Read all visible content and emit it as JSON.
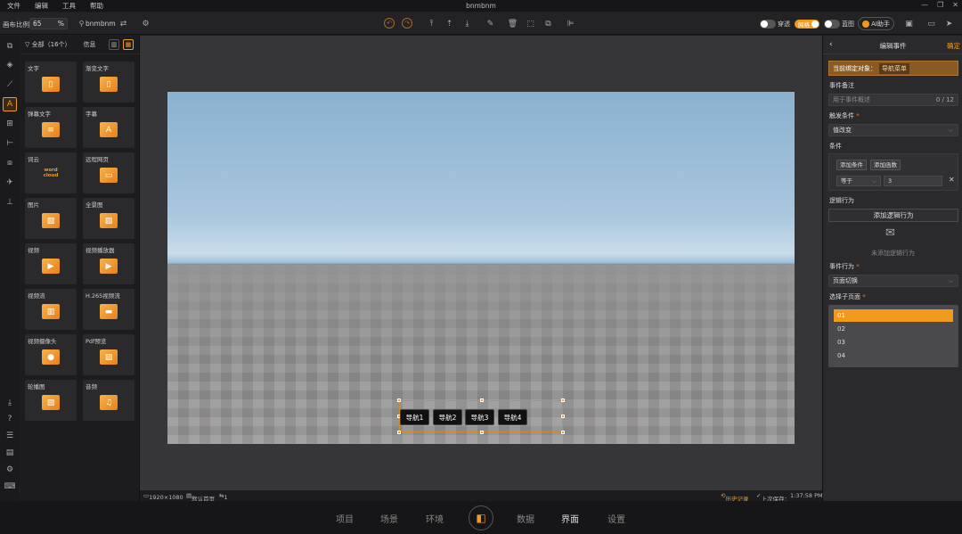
{
  "menubar": {
    "items": [
      "文件",
      "编辑",
      "工具",
      "帮助"
    ],
    "title": "bnmbnm",
    "window_controls": [
      "—",
      "❐",
      "✕"
    ]
  },
  "toolbar": {
    "zoom_label": "画布比例",
    "zoom_value": "65",
    "zoom_unit": "%",
    "project_name": "bnmbnm",
    "toggles": [
      {
        "label": "穿透",
        "on": false
      },
      {
        "label": "网格",
        "on": true
      },
      {
        "label": "蓝图",
        "on": false
      }
    ],
    "ai_label": "AI助手"
  },
  "component_panel": {
    "filter_label": "全部（16个）",
    "info_label": "信息",
    "items": [
      {
        "label": "文字",
        "icon": "▯"
      },
      {
        "label": "渐变文字",
        "icon": "▯"
      },
      {
        "label": "弹幕文字",
        "icon": "≡"
      },
      {
        "label": "字幕",
        "icon": "A"
      },
      {
        "label": "词云",
        "icon": "word cloud"
      },
      {
        "label": "远程网页",
        "icon": "▭"
      },
      {
        "label": "图片",
        "icon": "▨"
      },
      {
        "label": "全景图",
        "icon": "▨"
      },
      {
        "label": "视频",
        "icon": "▶"
      },
      {
        "label": "视频播放器",
        "icon": "▶"
      },
      {
        "label": "视频流",
        "icon": "▥"
      },
      {
        "label": "H.265视频流",
        "icon": "▬"
      },
      {
        "label": "视频摄像头",
        "icon": "●"
      },
      {
        "label": "Pdf预览",
        "icon": "▨"
      },
      {
        "label": "轮播图",
        "icon": "▨"
      },
      {
        "label": "音频",
        "icon": "♫"
      }
    ]
  },
  "canvas": {
    "nav_buttons": [
      "导航1",
      "导航2",
      "导航3",
      "导航4"
    ]
  },
  "statusbar": {
    "resolution": "1920×1080",
    "default_page": "默认首页",
    "link_count": "1",
    "history": "历史记录",
    "last_save": "上次保存：",
    "save_time": "1:37:58 PM"
  },
  "right_panel": {
    "back": "‹",
    "title": "编辑事件",
    "confirm": "确定",
    "bind_label": "当前绑定对象：",
    "bind_target": "导航菜单",
    "note_label": "事件备注",
    "note_placeholder": "用于事件概述",
    "note_count": "0 / 12",
    "trigger_label": "触发条件",
    "trigger_value": "值改变",
    "condition_label": "条件",
    "add_condition": "添加条件",
    "add_function": "添加函数",
    "operator": "等于",
    "operand": "3",
    "logic_label": "逻辑行为",
    "add_logic": "添加逻辑行为",
    "logic_empty": "未添加逻辑行为",
    "action_label": "事件行为",
    "action_value": "页面切换",
    "subpage_label": "选择子页面",
    "subpages": [
      "01",
      "02",
      "03",
      "04"
    ],
    "selected_subpage": "01"
  },
  "bottom_tabs": {
    "items": [
      "项目",
      "场景",
      "环境",
      "数据",
      "界面",
      "设置"
    ],
    "active": "界面"
  },
  "colors": {
    "accent": "#f29a1c",
    "bind_bar": "#8a5a22"
  }
}
